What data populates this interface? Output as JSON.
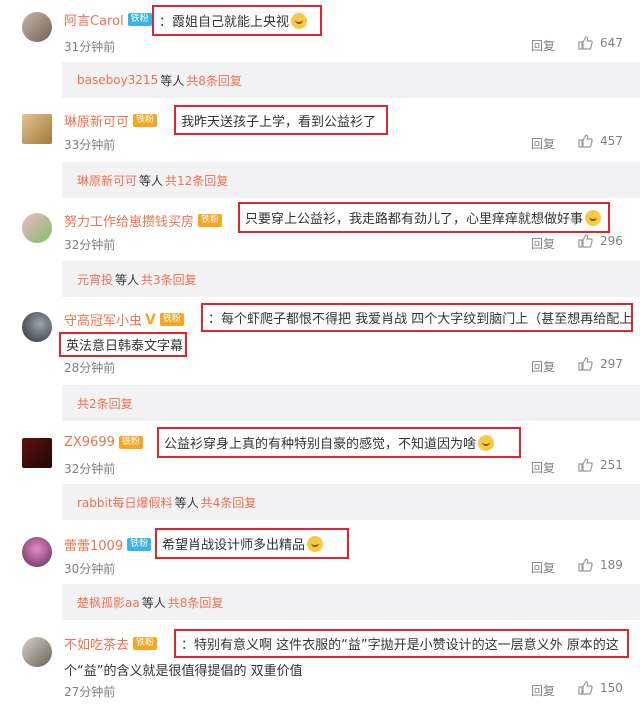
{
  "comments": [
    {
      "user": "阿言Carol",
      "badge": "铁粉",
      "text": "：霞姐自己就能上央视",
      "time": "31分钟前",
      "reply": "回复",
      "likes": "647",
      "sub": {
        "name": "baseboy3215",
        "mid": "等人",
        "count": "共8条回复"
      }
    },
    {
      "user": "琳原新可可",
      "badge": "铁粉",
      "text": "我昨天送孩子上学，看到公益衫了",
      "time": "33分钟前",
      "reply": "回复",
      "likes": "457",
      "sub": {
        "name": "琳原新可可",
        "mid": "等人",
        "count": "共12条回复"
      }
    },
    {
      "user": "努力工作给崽攒钱买房",
      "badge": "铁粉",
      "text": "只要穿上公益衫，我走路都有劲儿了，心里痒痒就想做好事",
      "time": "32分钟前",
      "reply": "回复",
      "likes": "296",
      "sub": {
        "name": "元宵投",
        "mid": "等人",
        "count": "共3条回复"
      }
    },
    {
      "user": "守高冠军小虫",
      "badge": "铁粉",
      "text1": "：每个虾爬子都恨不得把 我爱肖战 四个大字纹到脑门上（甚至想再给配上",
      "text2": "英法意日韩泰文字幕",
      "time": "28分钟前",
      "reply": "回复",
      "likes": "297",
      "sub": {
        "count": "共2条回复"
      }
    },
    {
      "user": "ZX9699",
      "badge": "铁粉",
      "text": "公益衫穿身上真的有种特别自豪的感觉，不知道因为啥",
      "time": "32分钟前",
      "reply": "回复",
      "likes": "251",
      "sub": {
        "name": "rabbit每日爆假料",
        "mid": "等人",
        "count": "共4条回复"
      }
    },
    {
      "user": "蕾蕾1009",
      "badge": "铁粉",
      "text": "希望肖战设计师多出精品",
      "time": "30分钟前",
      "reply": "回复",
      "likes": "189",
      "sub": {
        "name": "楚枫孤影aa",
        "mid": "等人",
        "count": "共8条回复"
      }
    },
    {
      "user": "不如吃茶去",
      "badge": "铁粉",
      "text1": "：特别有意义啊  这件衣服的“益”字拋开是小赞设计的这一层意义外  原本的这",
      "text2": "个“益”的含义就是很值得提倡的  双重价值",
      "time": "27分钟前",
      "reply": "回复",
      "likes": "150"
    }
  ],
  "colors": {
    "username": "#eb7350",
    "highlight": "#e0252b",
    "subbg": "#f2f2f5",
    "fan": "#f5a623",
    "tie": "#3bb3e6"
  },
  "icons": {
    "like": "thumbs-up-icon",
    "fan": "heart-fan-icon",
    "emoji": "emoji-icon",
    "verified": "v-verified-icon"
  }
}
